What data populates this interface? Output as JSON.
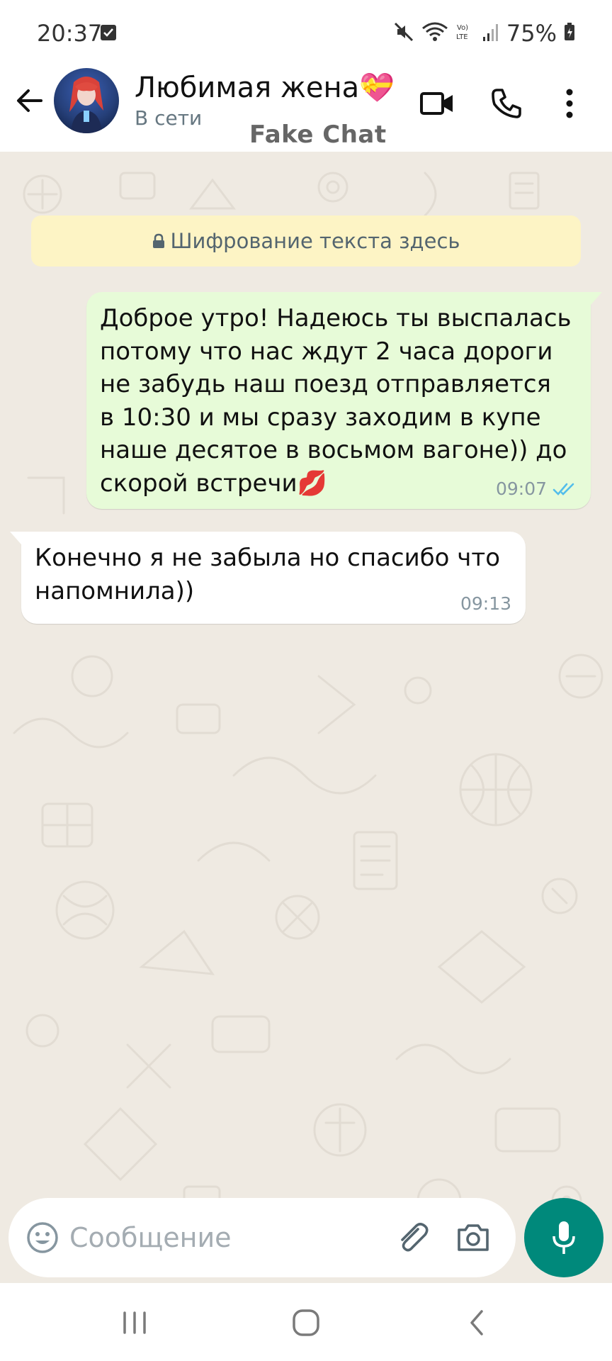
{
  "status_bar": {
    "time": "20:37",
    "battery": "75%",
    "icons": [
      "notification-check-icon",
      "mute-icon",
      "wifi-icon",
      "volte-icon",
      "signal-icon",
      "battery-icon"
    ]
  },
  "header": {
    "contact_name": "Любимая жена💝",
    "contact_status": "В сети",
    "watermark": "Fake Chat",
    "icons": [
      "back-arrow-icon",
      "video-camera-icon",
      "phone-icon",
      "more-vertical-icon"
    ]
  },
  "chat": {
    "encryption_notice": "Шифрование текста здесь",
    "messages": [
      {
        "direction": "outgoing",
        "text": "Доброе утро! Надеюсь ты выспалась\nпотому что нас ждут 2 часа дороги\nне забудь наш поезд отправляется\nв 10:30 и мы сразу заходим в купе\nнаше десятое в восьмом вагоне)) до\nскорой встречи💋",
        "time": "09:07",
        "status": "read"
      },
      {
        "direction": "incoming",
        "text": "Конечно я не забыла но спасибо что\nнапомнила))",
        "time": "09:13"
      }
    ]
  },
  "composer": {
    "placeholder": "Сообщение",
    "value": ""
  },
  "colors": {
    "accent": "#00897b",
    "outgoing_bubble": "#e7fbd8",
    "incoming_bubble": "#ffffff",
    "chat_background": "#efeae2",
    "banner": "#fdf4c5",
    "read_tick": "#53bdeb"
  }
}
